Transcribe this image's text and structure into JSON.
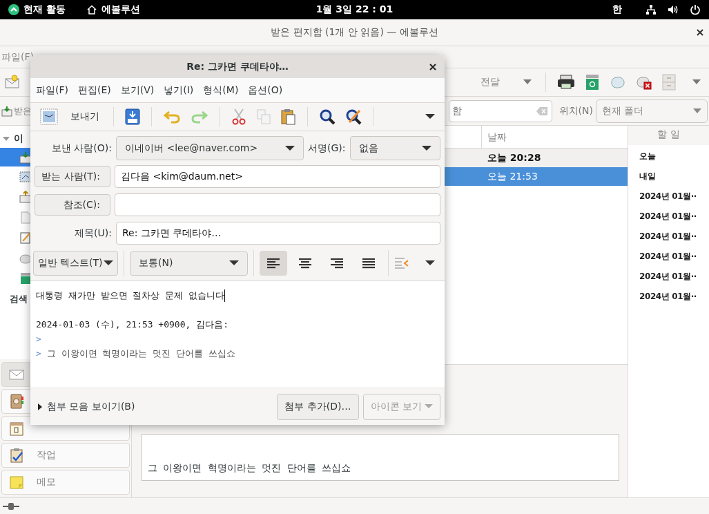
{
  "top_bar": {
    "activities": "현재 활동",
    "app_name": "에볼루션",
    "clock": "1월 3일 22 : 01",
    "input_method": "한"
  },
  "main_window": {
    "title": "받은 편지함 (1개 안 읽음) — 에볼루션",
    "menu": [
      "파일(F)"
    ],
    "toolbar": {
      "forward": "전달"
    },
    "search_bar": {
      "folder_label": "받은",
      "search_value": "함",
      "scope_label": "위치(N)",
      "scope": "현재 폴더"
    },
    "folders": {
      "account": "이",
      "expanded": true,
      "items": [
        {
          "kind": "inbox",
          "selected": true
        },
        {
          "kind": "drafts",
          "selected": false
        },
        {
          "kind": "outbox",
          "selected": false
        },
        {
          "kind": "document",
          "selected": false
        },
        {
          "kind": "templates",
          "selected": false
        },
        {
          "kind": "junk",
          "selected": false
        },
        {
          "kind": "trash",
          "selected": false
        }
      ],
      "search_folders": "검색"
    },
    "nav": [
      {
        "kind": "mail",
        "selected": true
      },
      {
        "kind": "contacts",
        "selected": false
      },
      {
        "kind": "calendar",
        "selected": false
      },
      {
        "kind": "tasks",
        "label": "작업",
        "selected": false
      },
      {
        "kind": "memos",
        "label": "메모",
        "selected": false
      }
    ],
    "message_list": {
      "columns": [
        "날짜"
      ],
      "rows": [
        {
          "date": "오늘 20:28",
          "unread": true,
          "selected": false
        },
        {
          "date": "오늘 21:53",
          "unread": false,
          "selected": true
        }
      ]
    },
    "preview": {
      "body": "그 이왕이면 혁명이라는 멋진 단어를 쓰십쇼"
    },
    "todo": {
      "title": "할 일",
      "groups": [
        "오늘",
        "내일",
        "2024년 01월··",
        "2024년 01월··",
        "2024년 01월··",
        "2024년 01월··",
        "2024년 01월··",
        "2024년 01월··"
      ]
    }
  },
  "compose": {
    "title": "Re: 그카면 쿠데타야…",
    "menu": [
      "파일(F)",
      "편집(E)",
      "보기(V)",
      "넣기(I)",
      "형식(M)",
      "옵션(O)"
    ],
    "send": "보내기",
    "from_label": "보낸 사람(O):",
    "from": "이네이버 <lee@naver.com>",
    "signature_label": "서명(G):",
    "signature": "없음",
    "to_button": "받는 사람(T):",
    "to": "김다음 <kim@daum.net>",
    "cc_button": "참조(C):",
    "subject_label": "제목(U):",
    "subject": "Re: 그카면 쿠데타야…",
    "format": "일반 텍스트(T)",
    "paragraph_style": "보통(N)",
    "alignment": [
      {
        "kind": "left",
        "selected": true
      },
      {
        "kind": "center",
        "selected": false
      },
      {
        "kind": "right",
        "selected": false
      },
      {
        "kind": "justify",
        "selected": false
      }
    ],
    "body": {
      "text": "대통령 재가만 받으면 절차상 문제 없습니다",
      "attribution": "2024-01-03 (수), 21:53 +0900, 김다음:",
      "quote": [
        {
          "marker": ">"
        },
        {
          "marker": ">",
          "text": "그 이왕이면 혁명이라는 멋진 단어를 쓰십쇼"
        }
      ]
    },
    "attachment_bar": {
      "label": "첨부 모음 보이기(B)",
      "expanded": false
    },
    "add_attachment": "첨부 추가(D)…",
    "view_mode": {
      "label": "아이콘 보기",
      "disabled": true
    }
  }
}
